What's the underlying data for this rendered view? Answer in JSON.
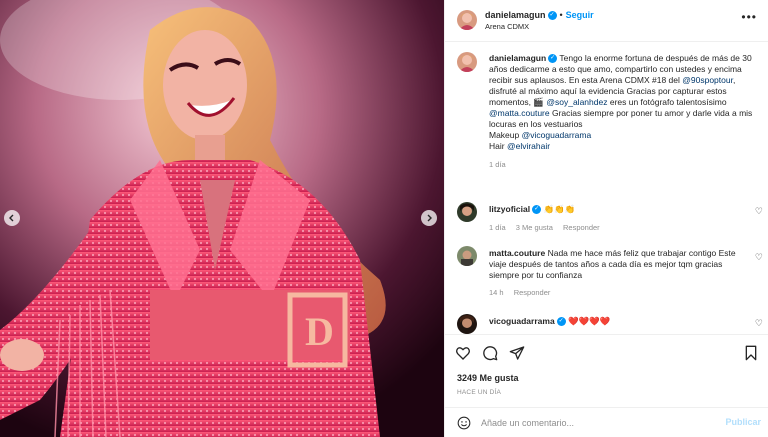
{
  "post": {
    "username": "danielamagun",
    "follow_label": "Seguir",
    "location": "Arena CDMX",
    "caption": {
      "username": "danielamagun",
      "text_1": "Tengo la enorme fortuna de después de más de 30 años dedicarme a esto que amo, compartirlo con ustedes y encima recibir sus aplausos. En esta Arena CDMX #18 del",
      "mention_tour": "@90spoptour",
      "text_2": ", disfruté al máximo aquí la evidencia Gracias por capturar estos momentos, 🎬",
      "mention_photographer": "@soy_alanhdez",
      "text_3": "eres un fotógrafo talentosísimo",
      "mention_couture": "@matta.couture",
      "text_4": "Gracias siempre por poner tu amor y darle vida a mis locuras en los vestuarios",
      "makeup_label": "Makeup",
      "mention_makeup": "@vicoguadarrama",
      "hair_label": "Hair",
      "mention_hair": "@elvirahair",
      "time": "1 día"
    },
    "comments": [
      {
        "username": "litzyoficial",
        "text": "👏👏👏",
        "time": "1 día",
        "likes": "3 Me gusta",
        "reply": "Responder"
      },
      {
        "username": "matta.couture",
        "text": "Nada me hace más feliz que trabajar contigo Este viaje después de tantos años a cada día es mejor tqm gracias siempre por tu confianza",
        "time": "14 h",
        "reply": "Responder"
      },
      {
        "username": "vicoguadarrama",
        "text": "❤️❤️❤️❤️"
      }
    ],
    "likes_label": "3249 Me gusta",
    "date_label": "HACE UN DÍA",
    "comment_placeholder": "Añade un comentario...",
    "publish_label": "Publicar"
  },
  "icons": {
    "more": "more-icon",
    "heart": "heart-icon",
    "comment": "comment-icon",
    "share": "share-icon",
    "save": "bookmark-icon",
    "emoji": "emoji-icon",
    "prev": "chevron-left-icon",
    "next": "chevron-right-icon"
  },
  "colors": {
    "accent": "#0095f6",
    "link": "#00376b",
    "muted": "#8e8e8e",
    "publish_disabled": "#b2dffc"
  }
}
